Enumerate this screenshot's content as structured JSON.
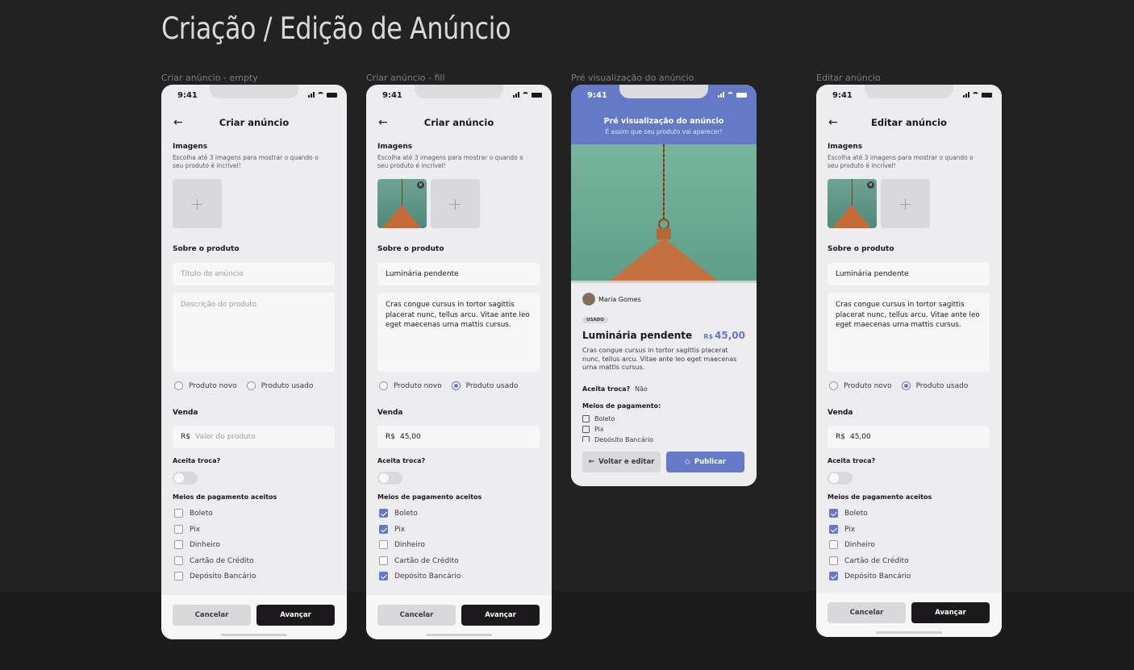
{
  "page": {
    "title": "Criação / Edição de Anúncio"
  },
  "status_time": "9:41",
  "screens": [
    {
      "label": "Criar anúncio - empty",
      "title": "Criar anúncio",
      "images_title": "Imagens",
      "images_sub": "Escolha até 3 imagens para mostrar o quando o seu produto é incrível!",
      "add_symbol": "+",
      "about_title": "Sobre o produto",
      "title_placeholder": "Título do anúncio",
      "desc_placeholder": "Descrição do produto",
      "radio_new": "Produto novo",
      "radio_used": "Produto usado",
      "sale_title": "Venda",
      "currency": "R$",
      "price_placeholder": "Valor do produto",
      "trade_title": "Aceita troca?",
      "payment_title": "Meios de pagamento aceitos",
      "payments": [
        "Boleto",
        "Pix",
        "Dinheiro",
        "Cartão de Crédito",
        "Depósito Bancário"
      ],
      "cancel": "Cancelar",
      "next": "Avançar"
    },
    {
      "label": "Criar anúncio - fill",
      "title": "Criar anúncio",
      "images_title": "Imagens",
      "images_sub": "Escolha até 3 imagens para mostrar o quando o seu produto é incrível!",
      "add_symbol": "+",
      "about_title": "Sobre o produto",
      "title_value": "Luminária pendente",
      "desc_value": "Cras congue cursus in tortor sagittis placerat nunc, tellus arcu. Vitae ante leo eget maecenas urna mattis cursus.",
      "radio_new": "Produto novo",
      "radio_used": "Produto usado",
      "sale_title": "Venda",
      "currency": "R$",
      "price_value": "45,00",
      "trade_title": "Aceita troca?",
      "payment_title": "Meios de pagamento aceitos",
      "payments": [
        "Boleto",
        "Pix",
        "Dinheiro",
        "Cartão de Crédito",
        "Depósito Bancário"
      ],
      "cancel": "Cancelar",
      "next": "Avançar"
    },
    {
      "label": "Pré visualização do anúncio",
      "head_title": "Pré visualização do anúncio",
      "head_sub": "É assim que seu produto vai aparecer!",
      "seller": "Maria Gomes",
      "badge": "USADO",
      "name": "Luminária pendente",
      "currency": "R$",
      "price": "45,00",
      "desc": "Cras congue cursus in tortor sagittis placerat nunc, tellus arcu. Vitae ante leo eget maecenas urna mattis cursus.",
      "trade_label": "Aceita troca?",
      "trade_value": "Não",
      "pay_title": "Meios de pagamento:",
      "pay_items": [
        "Boleto",
        "Pix",
        "Depósito Bancário"
      ],
      "back": "Voltar e editar",
      "publish": "Publicar"
    },
    {
      "label": "Editar anúncio",
      "title": "Editar anúncio",
      "images_title": "Imagens",
      "images_sub": "Escolha até 3 imagens para mostrar o quando o seu produto é incrível!",
      "add_symbol": "+",
      "about_title": "Sobre o produto",
      "title_value": "Luminária pendente",
      "desc_value": "Cras congue cursus in tortor sagittis placerat nunc, tellus arcu. Vitae ante leo eget maecenas urna mattis cursus.",
      "radio_new": "Produto novo",
      "radio_used": "Produto usado",
      "sale_title": "Venda",
      "currency": "R$",
      "price_value": "45,00",
      "trade_title": "Aceita troca?",
      "payment_title": "Meios de pagamento aceitos",
      "payments": [
        "Boleto",
        "Pix",
        "Dinheiro",
        "Cartão de Crédito",
        "Depósito Bancário"
      ],
      "cancel": "Cancelar",
      "next": "Avançar"
    }
  ],
  "colors": {
    "background": "#222222",
    "screen": "#EDECEE",
    "accent": "#647AC7",
    "dark_button": "#1A181B"
  },
  "icons": [
    "arrow-left-icon",
    "signal-icon",
    "wifi-icon",
    "battery-icon",
    "plus-icon",
    "close-icon",
    "tag-icon",
    "barcode-icon",
    "qrcode-icon",
    "bank-icon"
  ]
}
